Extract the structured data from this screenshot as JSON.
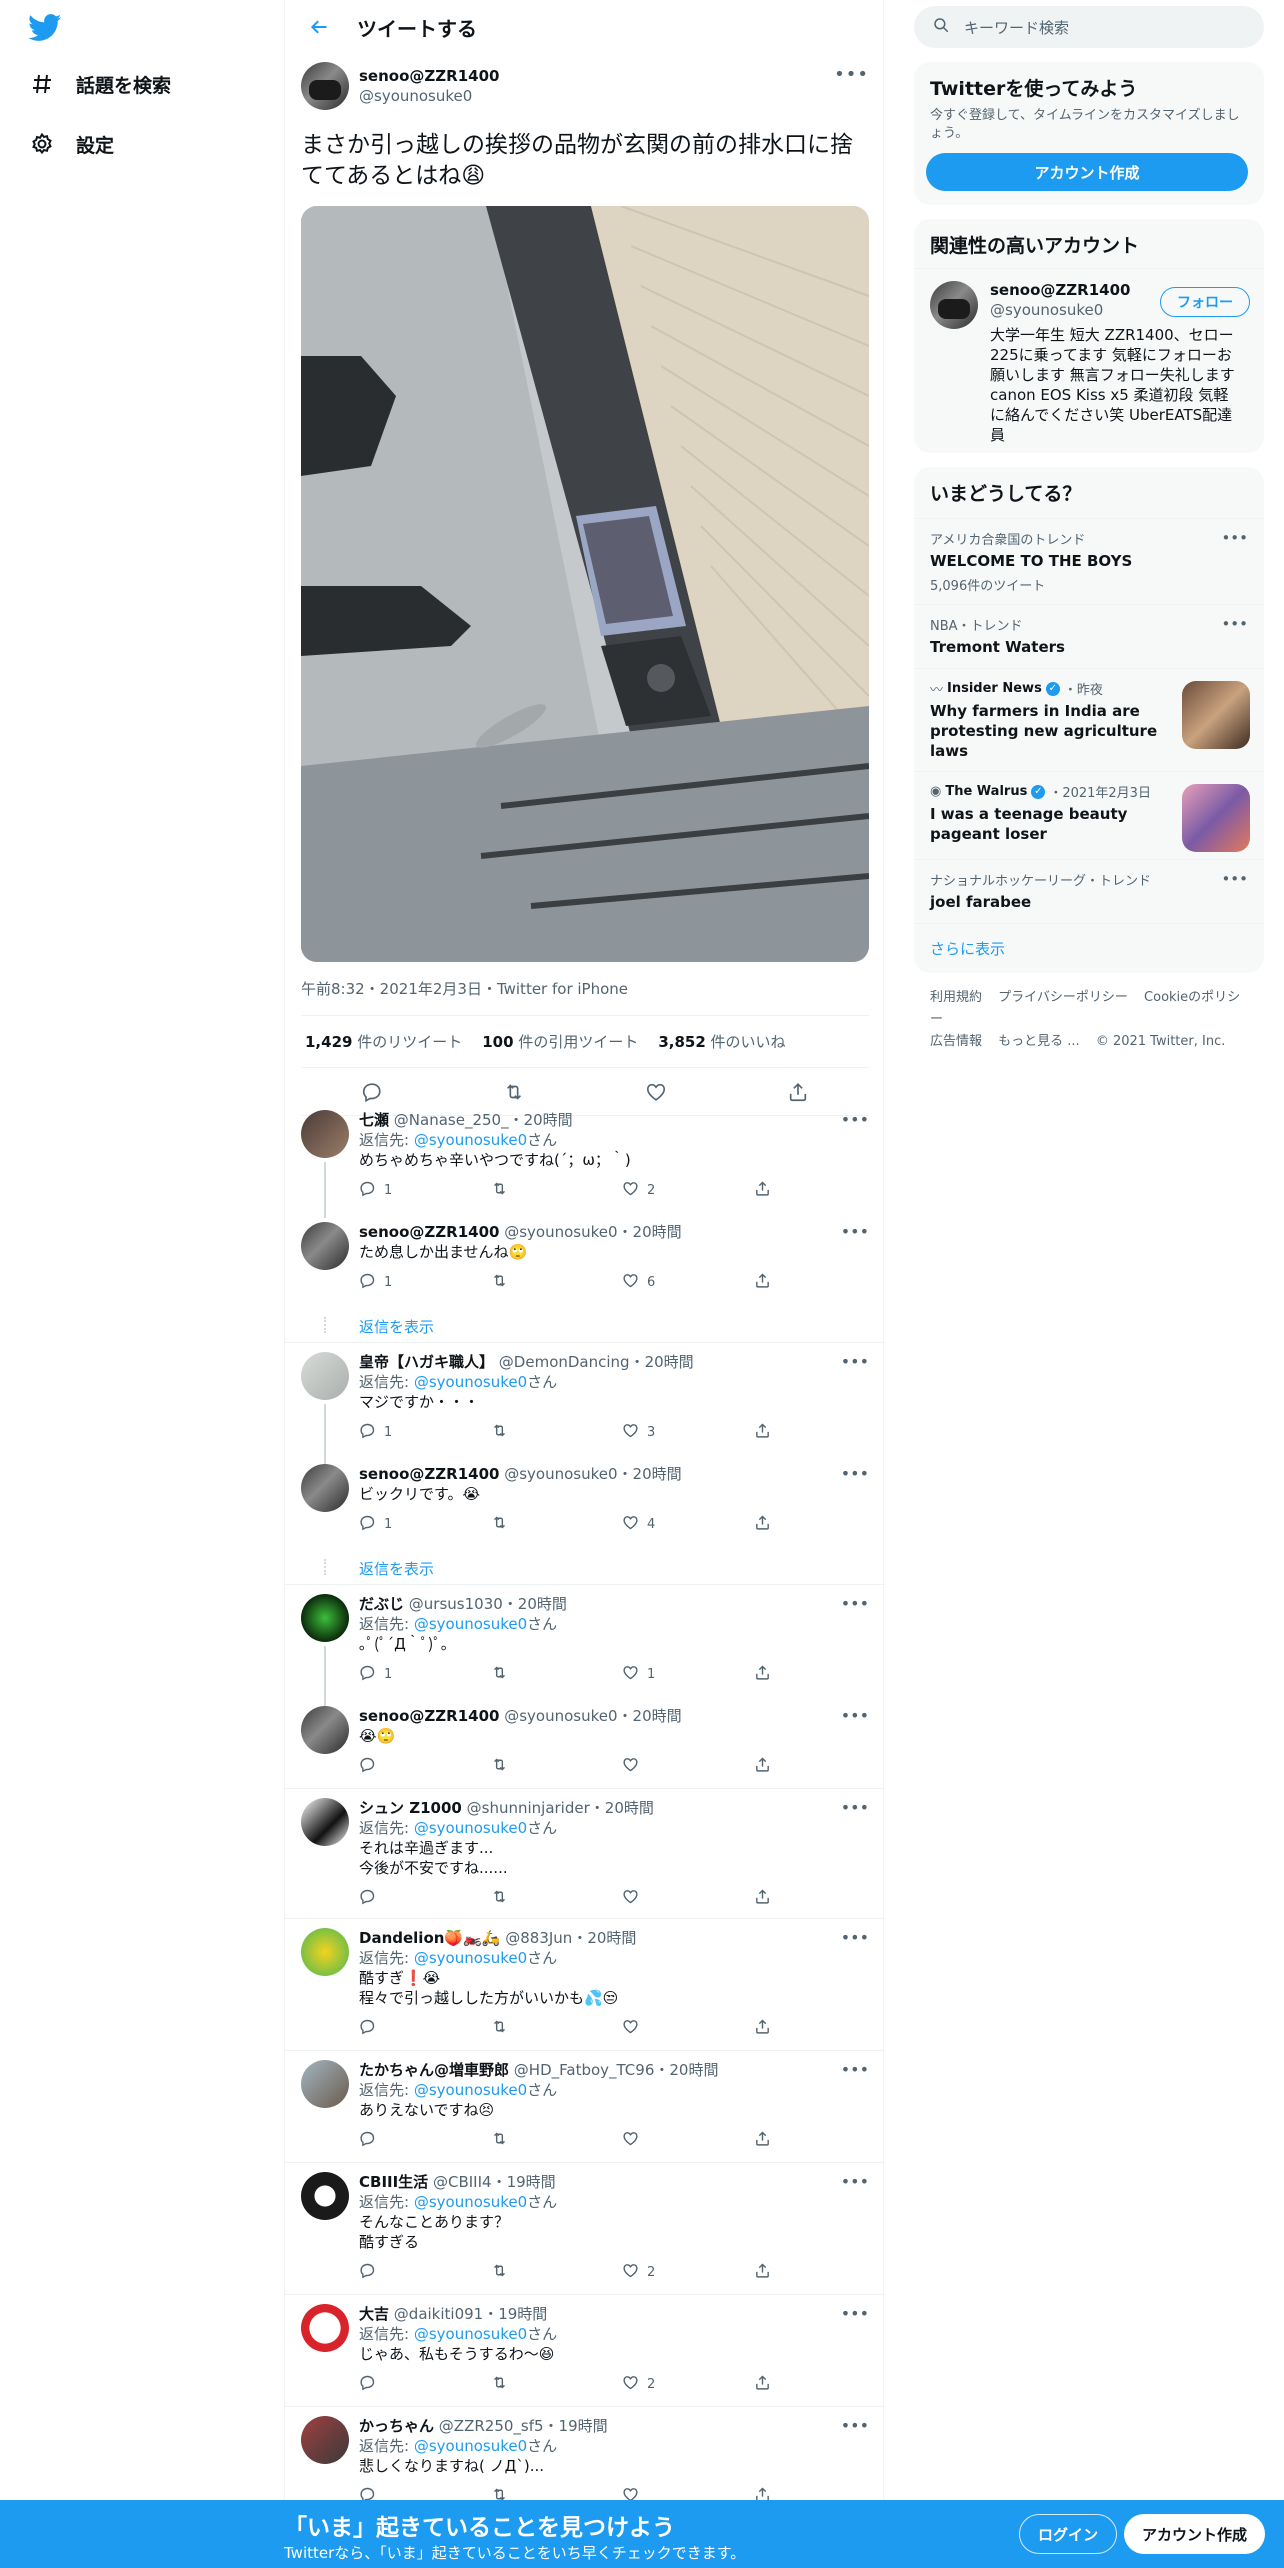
{
  "nav": {
    "explore": "話題を検索",
    "settings": "設定"
  },
  "header": {
    "title": "ツイートする"
  },
  "main_tweet": {
    "display_name": "senoo@ZZR1400",
    "username": "@syounosuke0",
    "text": "まさか引っ越しの挨拶の品物が玄関の前の排水口に捨ててあるとはね😩",
    "meta": "午前8:32・2021年2月3日・Twitter for iPhone",
    "retweets_num": "1,429",
    "retweets_label": " 件のリツイート",
    "quotes_num": "100",
    "quotes_label": " 件の引用ツイート",
    "likes_num": "3,852",
    "likes_label": " 件のいいね"
  },
  "replying_to_prefix": "返信先: ",
  "replying_to_handle": "@syounosuke0",
  "replying_to_suffix": "さん",
  "show_replies": "返信を表示",
  "replies": [
    {
      "display_name": "七瀬",
      "username": "@Nanase_250_",
      "time": "・20時間",
      "replying": true,
      "text": "めちゃめちゃ辛いやつですね(´；ω；｀)",
      "reply_count": "1",
      "retweet_count": "",
      "like_count": "2"
    },
    {
      "display_name": "senoo@ZZR1400",
      "username": "@syounosuke0",
      "time": "・20時間",
      "replying": false,
      "text": "ため息しか出ませんね🙄",
      "reply_count": "1",
      "retweet_count": "",
      "like_count": "6"
    },
    {
      "display_name": "皇帝【ハガキ職人】",
      "username": "@DemonDancing",
      "time": "・20時間",
      "replying": true,
      "text": "マジですか・・・",
      "reply_count": "1",
      "retweet_count": "",
      "like_count": "3"
    },
    {
      "display_name": "senoo@ZZR1400",
      "username": "@syounosuke0",
      "time": "・20時間",
      "replying": false,
      "text": "ビックリです。😭",
      "reply_count": "1",
      "retweet_count": "",
      "like_count": "4"
    },
    {
      "display_name": "だぶじ",
      "username": "@ursus1030",
      "time": "・20時間",
      "replying": true,
      "text": "｡ﾟ(ﾟ´Д｀ﾟ)ﾟ｡",
      "reply_count": "1",
      "retweet_count": "",
      "like_count": "1"
    },
    {
      "display_name": "senoo@ZZR1400",
      "username": "@syounosuke0",
      "time": "・20時間",
      "replying": false,
      "text": "😭🙄",
      "reply_count": "",
      "retweet_count": "",
      "like_count": ""
    },
    {
      "display_name": "シュン Z1000",
      "username": "@shunninjarider",
      "time": "・20時間",
      "replying": true,
      "text": "それは辛過ぎます...",
      "text2": "今後が不安ですね......",
      "reply_count": "",
      "retweet_count": "",
      "like_count": ""
    },
    {
      "display_name": "Dandelion🍑🏍️🛵",
      "username": "@883Jun",
      "time": "・20時間",
      "replying": true,
      "text": "酷すぎ❗️😭",
      "text2": "程々で引っ越しした方がいいかも💦😒",
      "reply_count": "",
      "retweet_count": "",
      "like_count": ""
    },
    {
      "display_name": "たかちゃん@増車野郎",
      "username": "@HD_Fatboy_TC96",
      "time": "・20時間",
      "replying": true,
      "text": "ありえないですね😣",
      "reply_count": "",
      "retweet_count": "",
      "like_count": ""
    },
    {
      "display_name": "CBIII生活",
      "username": "@CBIII4",
      "time": "・19時間",
      "replying": true,
      "text": "そんなことあります？",
      "text2": "酷すぎる",
      "reply_count": "",
      "retweet_count": "",
      "like_count": "2"
    },
    {
      "display_name": "大吉",
      "username": "@daikiti091",
      "time": "・19時間",
      "replying": true,
      "text": "じゃあ、私もそうするわ〜😆",
      "reply_count": "",
      "retweet_count": "",
      "like_count": "2"
    },
    {
      "display_name": "かっちゃん",
      "username": "@ZZR250_sf5",
      "time": "・19時間",
      "replying": true,
      "text": "悲しくなりますね( ノД`)...",
      "reply_count": "",
      "retweet_count": "",
      "like_count": ""
    }
  ],
  "right": {
    "search_placeholder": "キーワード検索",
    "signup_title": "Twitterを使ってみよう",
    "signup_sub": "今すぐ登録して、タイムラインをカスタマイズしましょう。",
    "signup_button": "アカウント作成",
    "relevant_title": "関連性の高いアカウント",
    "relevant_account": {
      "display_name": "senoo@ZZR1400",
      "username": "@syounosuke0",
      "follow": "フォロー",
      "bio": "大学一年生 短大 ZZR1400、セロー225に乗ってます 気軽にフォローお願いします 無言フォロー失礼します canon EOS Kiss x5 柔道初段 気軽に絡んでください笑 UberEATS配達員"
    },
    "trends_title": "いまどうしてる？",
    "trends": [
      {
        "meta": "アメリカ合衆国のトレンド",
        "name": "WELCOME TO THE BOYS",
        "count": "5,096件のツイート"
      },
      {
        "meta": "NBA・トレンド",
        "name": "Tremont Waters",
        "count": ""
      }
    ],
    "news": [
      {
        "source": "Insider News",
        "time": "・昨夜",
        "title": "Why farmers in India are protesting new agriculture laws"
      },
      {
        "source": "The Walrus",
        "time": "・2021年2月3日",
        "title": "I was a teenage beauty pageant loser"
      }
    ],
    "trend3": {
      "meta": "ナショナルホッケーリーグ・トレンド",
      "name": "joel farabee"
    },
    "show_more": "さらに表示",
    "footer": [
      "利用規約",
      "プライバシーポリシー",
      "Cookieのポリシー",
      "広告情報",
      "もっと見る ...",
      "© 2021 Twitter, Inc."
    ]
  },
  "bottom_bar": {
    "title": "「いま」起きていることを見つけよう",
    "subtitle": "Twitterなら、「いま」起きていることをいち早くチェックできます。",
    "login": "ログイン",
    "signup": "アカウント作成"
  },
  "colors": {
    "accent": "#1d9bf0",
    "text": "#0f1419",
    "muted": "#536471"
  }
}
